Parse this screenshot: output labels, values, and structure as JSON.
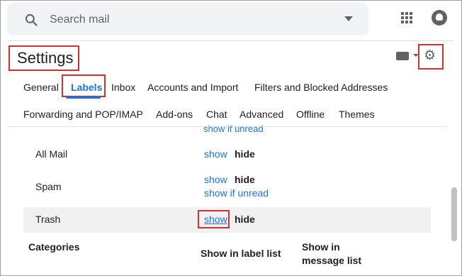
{
  "search": {
    "placeholder": "Search mail"
  },
  "header": {
    "title": "Settings"
  },
  "tabs_row1": [
    "General",
    "Labels",
    "Inbox",
    "Accounts and Import",
    "Filters and Blocked Addresses"
  ],
  "tabs_row2": [
    "Forwarding and POP/IMAP",
    "Add-ons",
    "Chat",
    "Advanced",
    "Offline",
    "Themes"
  ],
  "active_tab": "Labels",
  "rows": {
    "partial": {
      "show_if_unread": "show if unread"
    },
    "all_mail": {
      "name": "All Mail",
      "show": "show",
      "hide": "hide"
    },
    "spam": {
      "name": "Spam",
      "show": "show",
      "hide": "hide",
      "show_if_unread": "show if unread"
    },
    "trash": {
      "name": "Trash",
      "show": "show",
      "hide": "hide"
    }
  },
  "categories_header": {
    "title": "Categories",
    "col1": "Show in label list",
    "col2_line1": "Show in",
    "col2_line2": "message list"
  },
  "colors": {
    "accent": "#1a73e8",
    "highlight_box": "#d32f2f"
  }
}
